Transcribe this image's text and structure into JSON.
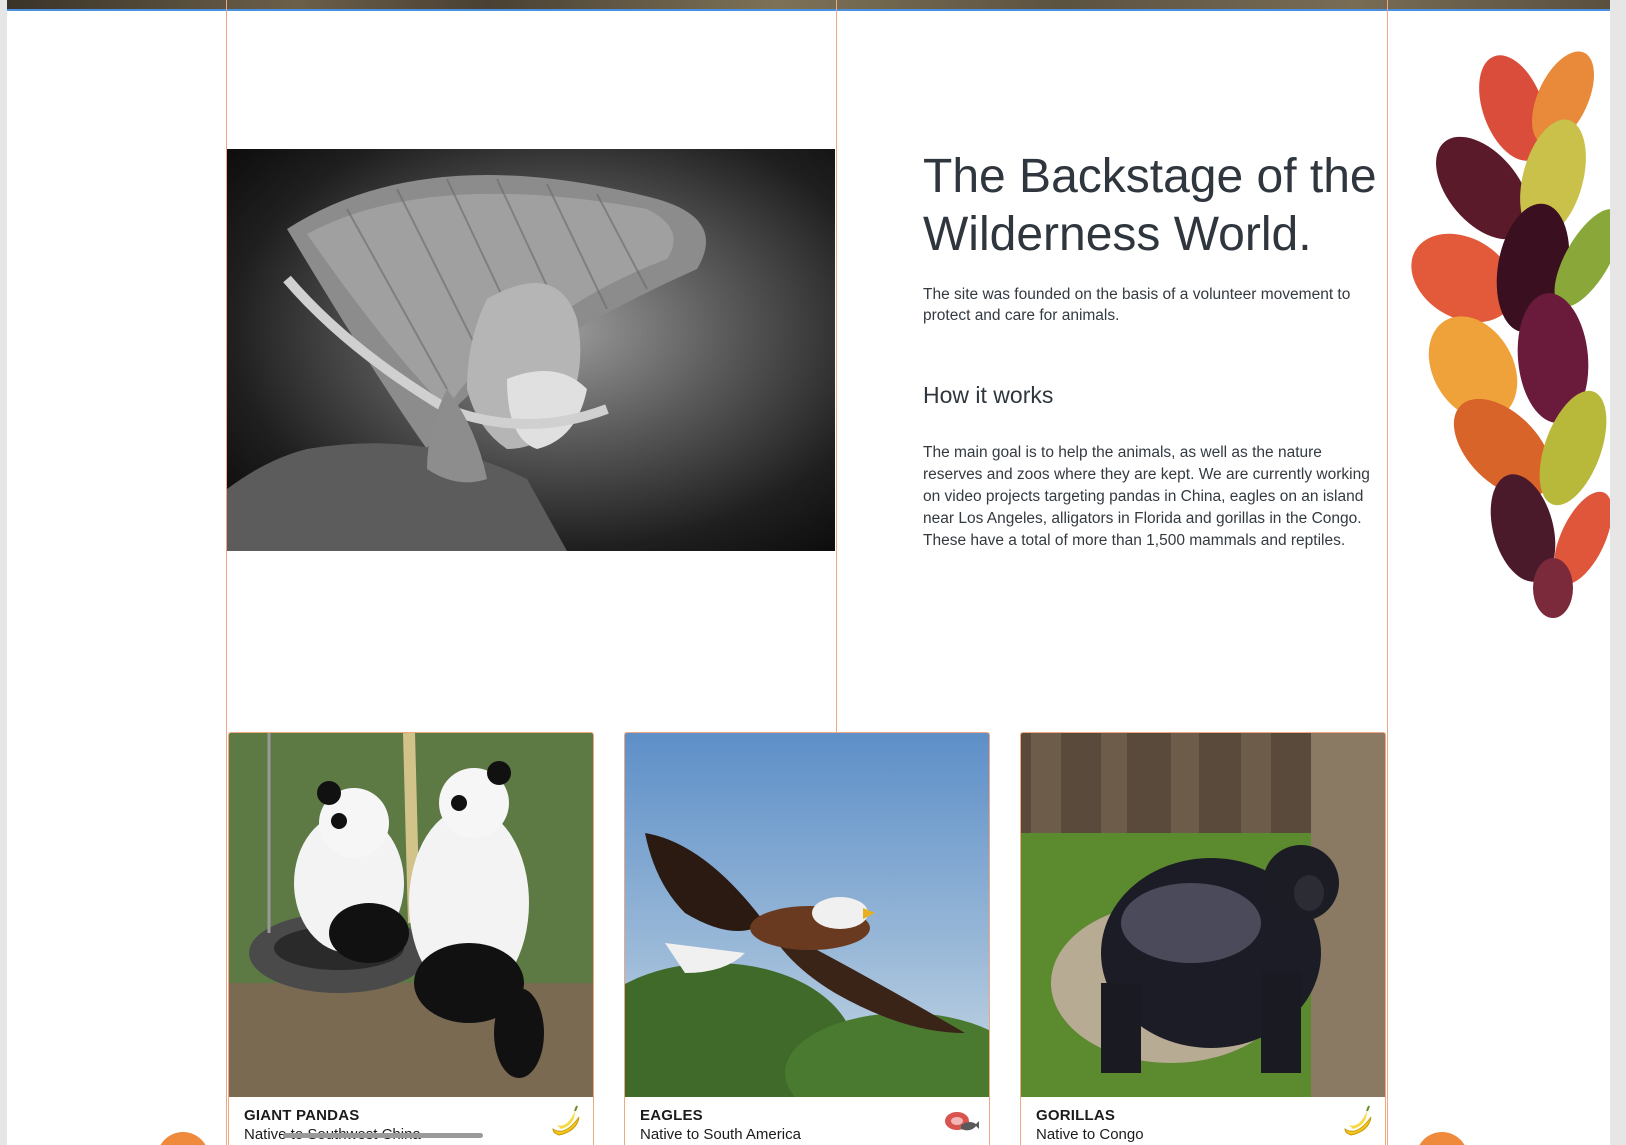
{
  "hero": {
    "title": "The Backstage of the Wilderness World.",
    "lead": "The site was founded on the basis of a volunteer movement to protect and care for animals.",
    "how_title": "How it works",
    "how_body": "The main goal is to help the animals, as well as the nature reserves and zoos where they are kept. We are currently working on video projects targeting pandas in China, eagles on an island near Los Angeles, alligators in Florida and gorillas in the Congo. These have a total of more than 1,500 mammals and reptiles."
  },
  "cards": [
    {
      "name": "GIANT PANDAS",
      "native": "Native to Southwest China",
      "food_icon": "banana-icon"
    },
    {
      "name": "EAGLES",
      "native": "Native to South America",
      "food_icon": "meat-fish-icon"
    },
    {
      "name": "GORILLAS",
      "native": "Native to Congo",
      "food_icon": "banana-icon"
    }
  ],
  "colors": {
    "accent": "#ef8a3c",
    "guide": "#f0a883",
    "text": "#2f363d",
    "selection": "#4a90e2"
  }
}
